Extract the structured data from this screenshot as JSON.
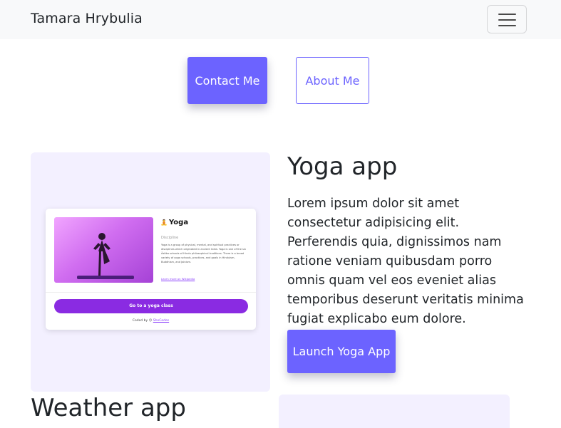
{
  "navbar": {
    "brand": "Tamara Hrybulia"
  },
  "hero_buttons": {
    "contact_label": "Contact Me",
    "about_label": "About Me"
  },
  "projects": [
    {
      "title": "Yoga app",
      "description": "Lorem ipsum dolor sit amet consectetur adipisicing elit. Perferendis quia, dignissimos nam ratione veniam quibusdam porro omnis quam vel eos eveniet alias temporibus deserunt veritatis minima fugiat explicabo eum dolore.",
      "button_label": "Launch Yoga App",
      "preview": {
        "icon": "lotus-icon",
        "app_title": "Yoga",
        "subtitle": "Discipline",
        "text": "Yoga is a group of physical, mental, and spiritual practices or disciplines which originated in ancient India. Yoga is one of the six Āstika schools of Hindu philosophical traditions. There is a broad variety of yoga schools, practices, and goals in Hinduism, Buddhism, and Jainism.",
        "link": "Learn more on Wikipedia",
        "cta": "Go to a yoga class",
        "footer_prefix": "Coded by",
        "footer_name": "SheCodes"
      }
    },
    {
      "title": "Weather app"
    }
  ],
  "colors": {
    "accent": "#6c63ff",
    "panel_bg": "#f3f0ff",
    "navbar_bg": "#f8f9fa",
    "yoga_purple": "#8a2be2"
  }
}
